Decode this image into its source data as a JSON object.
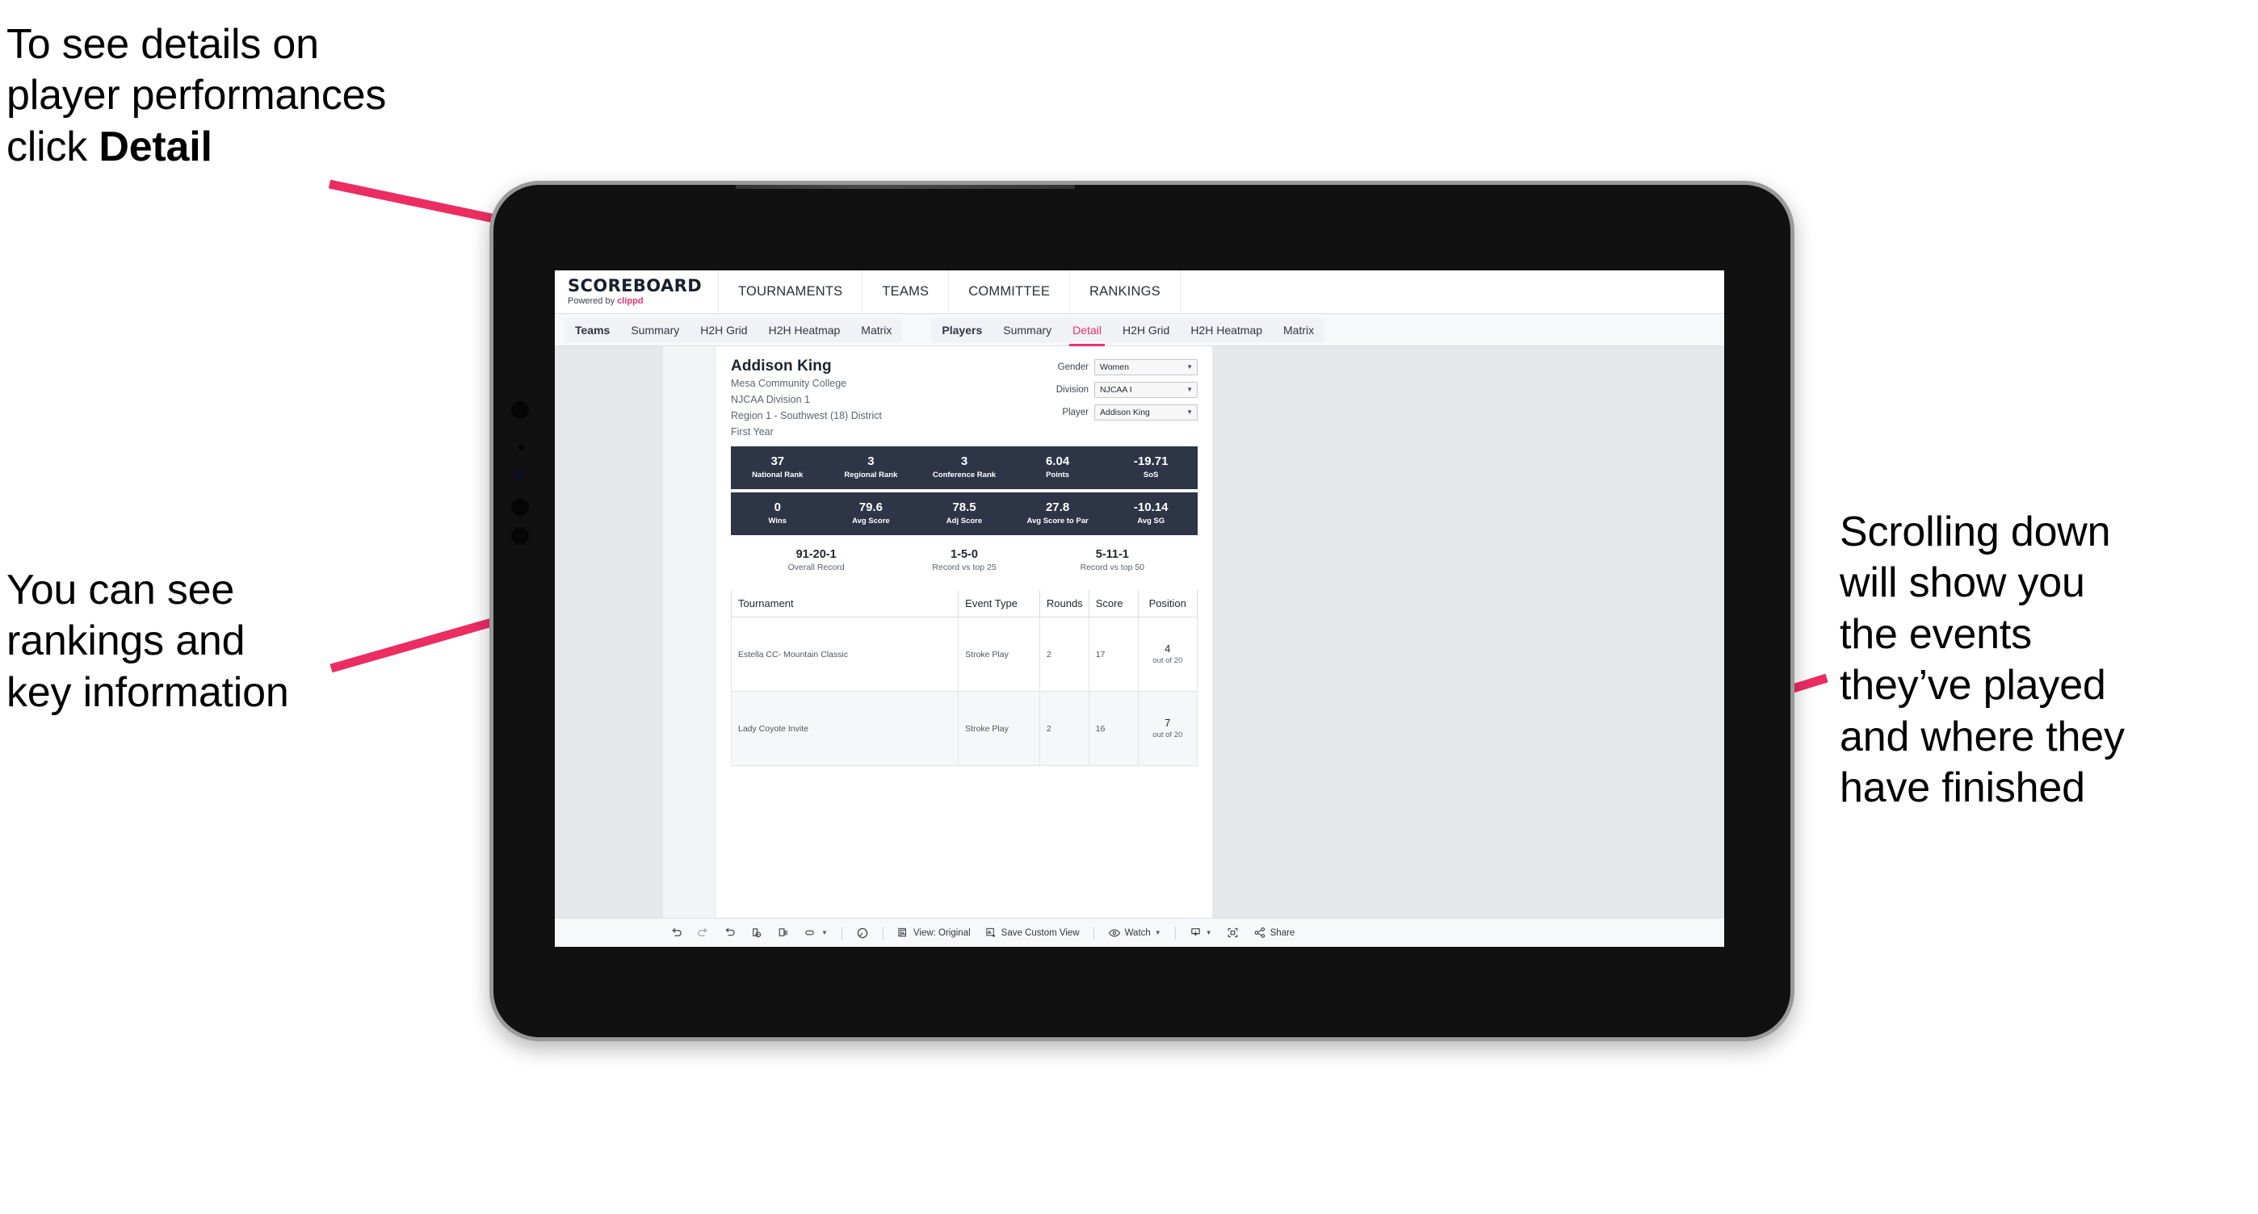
{
  "annotations": {
    "top_left": "To see details on\nplayer performances\nclick ",
    "top_left_bold": "Detail",
    "mid_left": "You can see\nrankings and\nkey information",
    "right": "Scrolling down\nwill show you\nthe events\nthey’ve played\nand where they\nhave finished",
    "arrow_color": "#ec2d62"
  },
  "app": {
    "brand": {
      "title": "SCOREBOARD",
      "powered_prefix": "Powered by ",
      "powered_brand": "clippd"
    },
    "top_nav": [
      "TOURNAMENTS",
      "TEAMS",
      "COMMITTEE",
      "RANKINGS"
    ],
    "sub_nav_teams": {
      "head": "Teams",
      "items": [
        "Summary",
        "H2H Grid",
        "H2H Heatmap",
        "Matrix"
      ]
    },
    "sub_nav_players": {
      "head": "Players",
      "items": [
        "Summary",
        "Detail",
        "H2H Grid",
        "H2H Heatmap",
        "Matrix"
      ],
      "active": "Detail"
    }
  },
  "player": {
    "name": "Addison King",
    "school": "Mesa Community College",
    "division": "NJCAA Division 1",
    "region": "Region 1 - Southwest (18) District",
    "year": "First Year"
  },
  "filters": [
    {
      "label": "Gender",
      "value": "Women"
    },
    {
      "label": "Division",
      "value": "NJCAA I"
    },
    {
      "label": "Player",
      "value": "Addison King"
    }
  ],
  "stats_band_1": [
    {
      "value": "37",
      "label": "National Rank"
    },
    {
      "value": "3",
      "label": "Regional Rank"
    },
    {
      "value": "3",
      "label": "Conference Rank"
    },
    {
      "value": "6.04",
      "label": "Points"
    },
    {
      "value": "-19.71",
      "label": "SoS"
    }
  ],
  "stats_band_2": [
    {
      "value": "0",
      "label": "Wins"
    },
    {
      "value": "79.6",
      "label": "Avg Score"
    },
    {
      "value": "78.5",
      "label": "Adj Score"
    },
    {
      "value": "27.8",
      "label": "Avg Score to Par"
    },
    {
      "value": "-10.14",
      "label": "Avg SG"
    }
  ],
  "records": [
    {
      "value": "91-20-1",
      "label": "Overall Record"
    },
    {
      "value": "1-5-0",
      "label": "Record vs top 25"
    },
    {
      "value": "5-11-1",
      "label": "Record vs top 50"
    }
  ],
  "table": {
    "columns": [
      "Tournament",
      "Event Type",
      "Rounds",
      "Score",
      "Position"
    ],
    "rows": [
      {
        "tournament": "Estella CC- Mountain Classic",
        "event_type": "Stroke Play",
        "rounds": "2",
        "score": "17",
        "position": "4",
        "position_sub": "out of 20"
      },
      {
        "tournament": "Lady Coyote Invite",
        "event_type": "Stroke Play",
        "rounds": "2",
        "score": "16",
        "position": "7",
        "position_sub": "out of 20"
      }
    ]
  },
  "toolbar": {
    "view_label": "View: Original",
    "save_label": "Save Custom View",
    "watch_label": "Watch",
    "share_label": "Share"
  },
  "colors": {
    "accent_pink": "#e8336e",
    "band_navy": "#2e3547",
    "canvas_grey": "#e6e7eb"
  }
}
